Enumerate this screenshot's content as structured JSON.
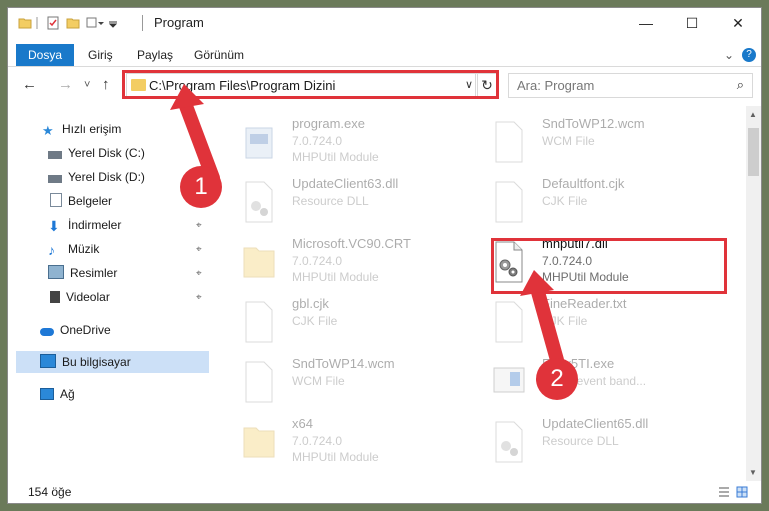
{
  "window": {
    "title": "Program",
    "minimize": "—",
    "maximize": "☐",
    "close": "✕"
  },
  "ribbon": {
    "tabs": [
      "Dosya",
      "Giriş",
      "Paylaş",
      "Görünüm"
    ],
    "expand": "⌄",
    "help": "?"
  },
  "address": {
    "back": "←",
    "forward": "→",
    "recent": "˅",
    "up": "↑",
    "path": "C:\\Program Files\\Program Dizini",
    "dropdown": "∨",
    "refresh": "↻",
    "search_placeholder": "Ara: Program",
    "search_icon": "⌕"
  },
  "nav": {
    "items": [
      {
        "label": "Hızlı erişim",
        "icon": "star-icon",
        "color": "#2b88d8"
      },
      {
        "label": "Yerel Disk (C:)",
        "icon": "drive-icon",
        "color": "#6f7a86",
        "pinned": true
      },
      {
        "label": "Yerel Disk (D:)",
        "icon": "drive-icon",
        "color": "#6f7a86",
        "pinned": true
      },
      {
        "label": "Belgeler",
        "icon": "documents-icon",
        "color": "#7a8a9a",
        "pinned": true
      },
      {
        "label": "İndirmeler",
        "icon": "downloads-icon",
        "color": "#1e78d6",
        "pinned": true
      },
      {
        "label": "Müzik",
        "icon": "music-icon",
        "color": "#1e78d6",
        "pinned": true
      },
      {
        "label": "Resimler",
        "icon": "pictures-icon",
        "color": "#4a6f8f",
        "pinned": true
      },
      {
        "label": "Videolar",
        "icon": "videos-icon",
        "color": "#444",
        "pinned": true
      },
      {
        "label": "OneDrive",
        "icon": "cloud-icon",
        "color": "#1e78d6"
      },
      {
        "label": "Bu bilgisayar",
        "icon": "computer-icon",
        "color": "#2b88d8",
        "selected": true
      },
      {
        "label": "Ağ",
        "icon": "network-icon",
        "color": "#2b88d8"
      }
    ],
    "pin_glyph": "⌖"
  },
  "files": [
    {
      "name": "program.exe",
      "line2": "7.0.724.0",
      "line3": "MHPUtil Module",
      "icon": "exe-icon"
    },
    {
      "name": "SndToWP12.wcm",
      "line2": "WCM File",
      "line3": "",
      "icon": "document-icon"
    },
    {
      "name": "UpdateClient63.dll",
      "line2": "Resource DLL",
      "line3": "",
      "icon": "dll-icon"
    },
    {
      "name": "Defaultfont.cjk",
      "line2": "CJK File",
      "line3": "",
      "icon": "document-icon"
    },
    {
      "name": "Microsoft.VC90.CRT",
      "line2": "7.0.724.0",
      "line3": "MHPUtil Module",
      "icon": "folder-icon"
    },
    {
      "name": "mhputil7.dll",
      "line2": "7.0.724.0",
      "line3": "MHPUtil Module",
      "icon": "dll-icon",
      "focus": true
    },
    {
      "name": "gbl.cjk",
      "line2": "CJK File",
      "line3": "",
      "icon": "document-icon"
    },
    {
      "name": "FineReader.txt",
      "line2": "CJK File",
      "line3": "",
      "icon": "document-icon"
    },
    {
      "name": "SndToWP14.wcm",
      "line2": "WCM File",
      "line3": "",
      "icon": "document-icon"
    },
    {
      "name": "Easy5TI.exe",
      "line2": "Coast event band...",
      "line3": "",
      "icon": "app-icon"
    },
    {
      "name": "x64",
      "line2": "7.0.724.0",
      "line3": "MHPUtil Module",
      "icon": "folder-icon"
    },
    {
      "name": "UpdateClient65.dll",
      "line2": "Resource DLL",
      "line3": "",
      "icon": "dll-icon"
    }
  ],
  "status": {
    "count": "154 öğe"
  },
  "annotations": {
    "badge1": "1",
    "badge2": "2",
    "color": "#e0333a"
  }
}
